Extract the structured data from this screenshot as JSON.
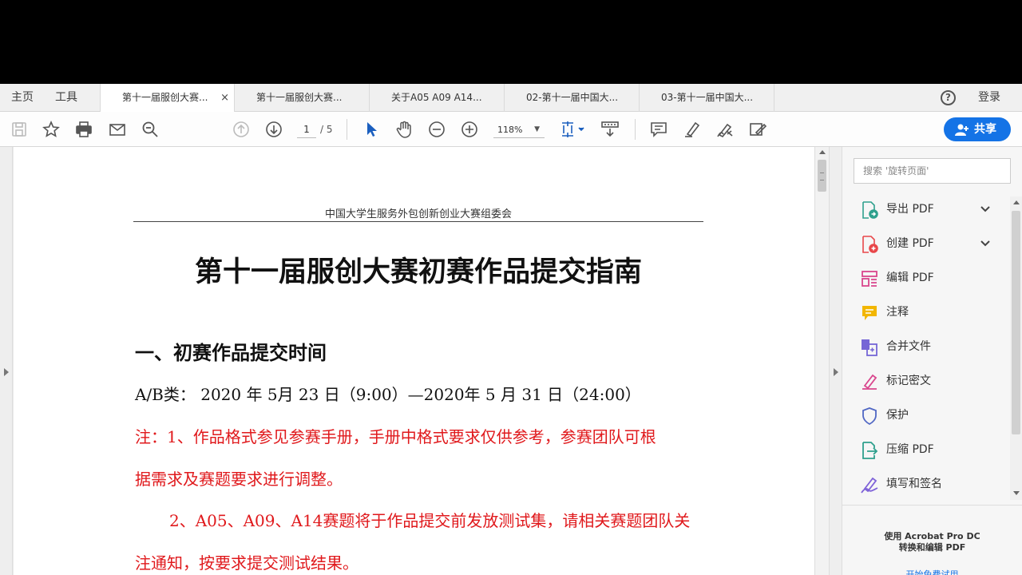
{
  "nav": {
    "home": "主页",
    "tools": "工具",
    "login": "登录"
  },
  "tabs": [
    {
      "label": "第十一届服创大赛..."
    },
    {
      "label": "第十一届服创大赛..."
    },
    {
      "label": "关于A05 A09 A14..."
    },
    {
      "label": "02-第十一届中国大..."
    },
    {
      "label": "03-第十一届中国大..."
    }
  ],
  "tab_close": "×",
  "help_glyph": "?",
  "toolbar": {
    "page_current": "1",
    "page_total": "/ 5",
    "zoom": "118%",
    "share_label": "共享"
  },
  "document": {
    "header": "中国大学生服务外包创新创业大赛组委会",
    "title": "第十一届服创大赛初赛作品提交指南",
    "section1": "一、初赛作品提交时间",
    "line1": "A/B类： 2020 年 5月 23 日（9:00）—2020年 5 月 31 日（24:00）",
    "note1": "注：1、作品格式参见参赛手册，手册中格式要求仅供参考，参赛团队可根",
    "note1b": "据需求及赛题要求进行调整。",
    "note2": "2、A05、A09、A14赛题将于作品提交前发放测试集，请相关赛题团队关",
    "note2b": "注通知，按要求提交测试结果。"
  },
  "right_panel": {
    "search_placeholder": "搜索 '旋转页面'",
    "tools": [
      {
        "label": "导出 PDF",
        "icon": "export-pdf-icon",
        "color": "#2fa08d"
      },
      {
        "label": "创建 PDF",
        "icon": "create-pdf-icon",
        "color": "#e8474a"
      },
      {
        "label": "编辑 PDF",
        "icon": "edit-pdf-icon",
        "color": "#d9468d"
      },
      {
        "label": "注释",
        "icon": "comment-icon",
        "color": "#f2b600"
      },
      {
        "label": "合并文件",
        "icon": "combine-files-icon",
        "color": "#7667d6"
      },
      {
        "label": "标记密文",
        "icon": "redact-icon",
        "color": "#d9468d"
      },
      {
        "label": "保护",
        "icon": "protect-icon",
        "color": "#5067c4"
      },
      {
        "label": "压缩 PDF",
        "icon": "compress-pdf-icon",
        "color": "#2fa08d"
      },
      {
        "label": "填写和签名",
        "icon": "fill-sign-icon",
        "color": "#7e62d8"
      }
    ],
    "promo_line1": "使用 Acrobat Pro DC",
    "promo_line2": "转换和编辑 PDF",
    "promo_link": "开始免费试用"
  }
}
